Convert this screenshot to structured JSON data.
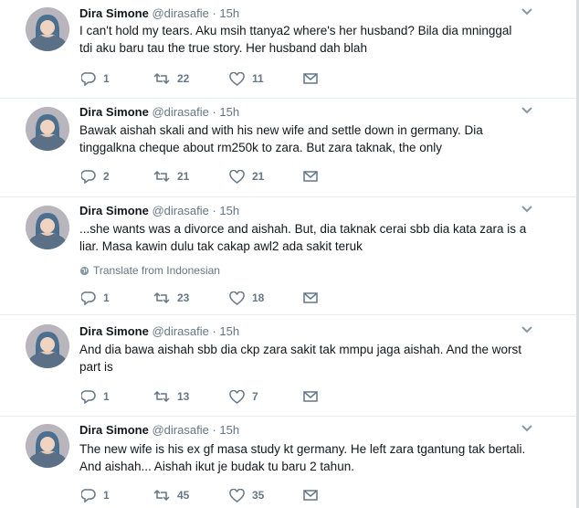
{
  "tweets": [
    {
      "name": "Dira Simone",
      "handle": "@dirasafie",
      "separator": "·",
      "time": "15h",
      "text_lines": [
        "I can't hold my tears. Aku msih ttanya2 where's her husband? Bila dia mninggal",
        "tdi aku baru tau the true story. Her husband dah blah"
      ],
      "translate": "",
      "replies": "1",
      "retweets": "22",
      "likes": "11"
    },
    {
      "name": "Dira Simone",
      "handle": "@dirasafie",
      "separator": "·",
      "time": "15h",
      "text_lines": [
        "Bawak aishah skali and with his new wife and settle down in germany. Dia",
        "tinggalkna cheque about rm250k to zara. But zara taknak, the only"
      ],
      "translate": "",
      "replies": "2",
      "retweets": "21",
      "likes": "21"
    },
    {
      "name": "Dira Simone",
      "handle": "@dirasafie",
      "separator": "·",
      "time": "15h",
      "text_lines": [
        "...she wants was a divorce and aishah. But, dia taknak cerai sbb dia kata zara is a",
        "liar. Masa kawin dulu tak cakap awl2 ada sakit teruk"
      ],
      "translate": "Translate from Indonesian",
      "replies": "1",
      "retweets": "23",
      "likes": "18"
    },
    {
      "name": "Dira Simone",
      "handle": "@dirasafie",
      "separator": "·",
      "time": "15h",
      "text_lines": [
        "And dia bawa aishah sbb dia ckp zara sakit tak mmpu jaga aishah. And the worst",
        "part is"
      ],
      "translate": "",
      "replies": "1",
      "retweets": "13",
      "likes": "7"
    },
    {
      "name": "Dira Simone",
      "handle": "@dirasafie",
      "separator": "·",
      "time": "15h",
      "text_lines": [
        "The new wife is his ex gf masa study kt germany. He left zara tgantung tak bertali.",
        "And aishah... Aishah ikut je budak tu baru 2 tahun."
      ],
      "translate": "",
      "replies": "1",
      "retweets": "45",
      "likes": "35"
    }
  ],
  "icons": {
    "reply": "reply-icon",
    "retweet": "retweet-icon",
    "like": "heart-icon",
    "message": "envelope-icon",
    "caret": "chevron-down-icon",
    "globe": "globe-icon"
  },
  "colors": {
    "text": "#14171a",
    "muted": "#657786",
    "divider": "#e6ecf0"
  }
}
